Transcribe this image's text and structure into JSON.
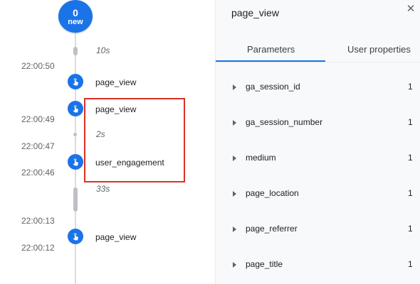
{
  "timeline": {
    "new_badge": {
      "count": "0",
      "label": "new"
    },
    "times": [
      "22:00:50",
      "22:00:49",
      "22:00:47",
      "22:00:46",
      "22:00:13",
      "22:00:12"
    ],
    "gaps": [
      "10s",
      "2s",
      "33s"
    ],
    "events": [
      "page_view",
      "page_view",
      "user_engagement",
      "page_view"
    ]
  },
  "panel": {
    "title": "page_view",
    "close_glyph": "✕",
    "tabs": [
      "Parameters",
      "User properties"
    ],
    "parameters": [
      {
        "name": "ga_session_id",
        "count": "1"
      },
      {
        "name": "ga_session_number",
        "count": "1"
      },
      {
        "name": "medium",
        "count": "1"
      },
      {
        "name": "page_location",
        "count": "1"
      },
      {
        "name": "page_referrer",
        "count": "1"
      },
      {
        "name": "page_title",
        "count": "1"
      }
    ]
  },
  "colors": {
    "accent": "#1a73e8",
    "highlight": "#d93025",
    "panel_bg": "#f8f9fa"
  },
  "icons": {
    "event": "touch-hand-icon",
    "param_expand": "caret-right-icon",
    "close": "close-icon"
  }
}
